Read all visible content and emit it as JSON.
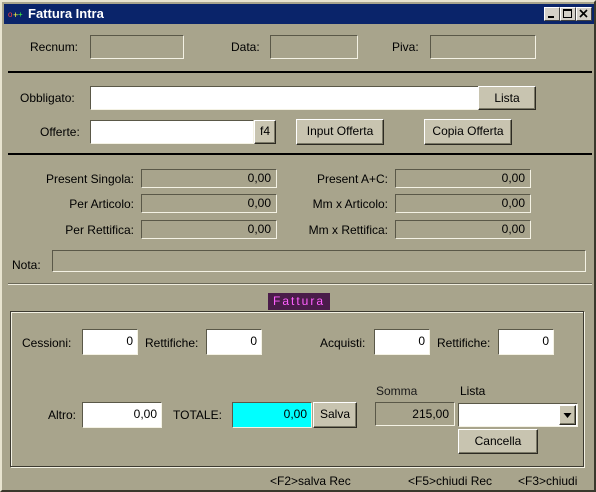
{
  "window": {
    "title": "Fattura Intra"
  },
  "header": {
    "recnum_label": "Recnum:",
    "data_label": "Data:",
    "piva_label": "Piva:"
  },
  "obbligato": {
    "label": "Obbligato:",
    "lista_button": "Lista"
  },
  "offerte": {
    "label": "Offerte:",
    "f4_button": "f4",
    "input_offerta_button": "Input Offerta",
    "copia_offerta_button": "Copia Offerta"
  },
  "totals": {
    "present_singola": {
      "label": "Present Singola:",
      "value": "0,00"
    },
    "per_articolo": {
      "label": "Per Articolo:",
      "value": "0,00"
    },
    "per_rettifica": {
      "label": "Per Rettifica:",
      "value": "0,00"
    },
    "present_ac": {
      "label": "Present A+C:",
      "value": "0,00"
    },
    "mm_articolo": {
      "label": "Mm x Articolo:",
      "value": "0,00"
    },
    "mm_rettifica": {
      "label": "Mm x Rettifica:",
      "value": "0,00"
    }
  },
  "nota": {
    "label": "Nota:"
  },
  "fattura": {
    "legend": "Fattura",
    "cessioni": {
      "label": "Cessioni:",
      "value": "0"
    },
    "rettifiche1": {
      "label": "Rettifiche:",
      "value": "0"
    },
    "acquisti": {
      "label": "Acquisti:",
      "value": "0"
    },
    "rettifiche2": {
      "label": "Rettifiche:",
      "value": "0"
    },
    "altro": {
      "label": "Altro:",
      "value": "0,00"
    },
    "totale": {
      "label": "TOTALE:",
      "value": "0,00"
    },
    "salva_button": "Salva",
    "somma": {
      "label": "Somma",
      "value": "215,00"
    },
    "lista": {
      "label": "Lista",
      "selected": ""
    },
    "cancella_button": "Cancella"
  },
  "shortcuts": {
    "f2": "<F2>salva Rec",
    "f5": "<F5>chiudi Rec",
    "f3": "<F3>chiudi"
  },
  "colors": {
    "titlebar": "#0a246a",
    "totale_field": "#00ffff",
    "legend_bg": "#4a1c4a",
    "legend_text": "#ff60ff"
  }
}
